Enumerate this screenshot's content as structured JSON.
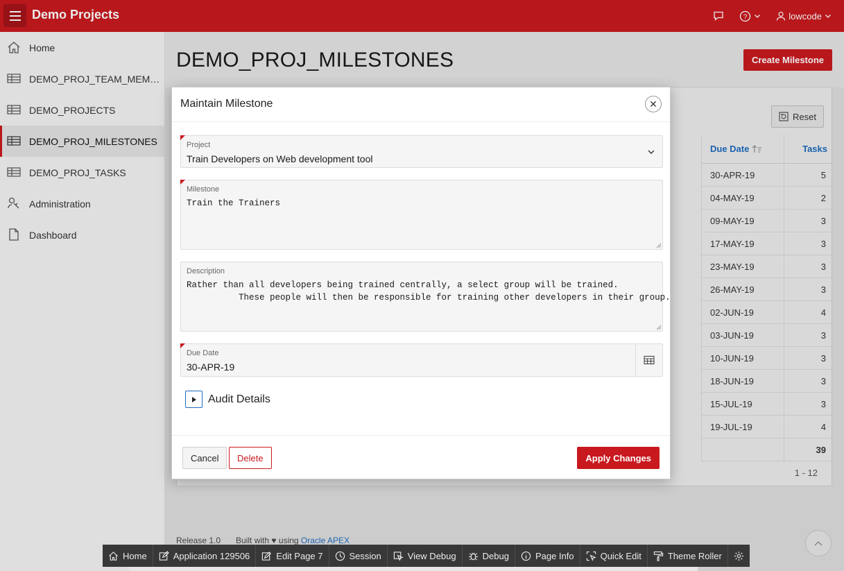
{
  "header": {
    "app_title": "Demo Projects",
    "user": "lowcode"
  },
  "sidebar": {
    "items": [
      {
        "label": "Home",
        "icon": "home-icon"
      },
      {
        "label": "DEMO_PROJ_TEAM_MEMBERS",
        "icon": "table-icon"
      },
      {
        "label": "DEMO_PROJECTS",
        "icon": "table-icon"
      },
      {
        "label": "DEMO_PROJ_MILESTONES",
        "icon": "table-icon",
        "active": true
      },
      {
        "label": "DEMO_PROJ_TASKS",
        "icon": "table-icon"
      },
      {
        "label": "Administration",
        "icon": "wrench-icon"
      },
      {
        "label": "Dashboard",
        "icon": "document-icon"
      }
    ]
  },
  "main": {
    "title": "DEMO_PROJ_MILESTONES",
    "create_label": "Create Milestone",
    "reset_label": "Reset",
    "columns": {
      "due_date": "Due Date",
      "tasks": "Tasks"
    },
    "rows": [
      {
        "due": "30-APR-19",
        "tasks": "5"
      },
      {
        "due": "04-MAY-19",
        "tasks": "2"
      },
      {
        "due": "09-MAY-19",
        "tasks": "3"
      },
      {
        "due": "17-MAY-19",
        "tasks": "3"
      },
      {
        "due": "23-MAY-19",
        "tasks": "3"
      },
      {
        "due": "26-MAY-19",
        "tasks": "3"
      },
      {
        "due": "02-JUN-19",
        "tasks": "4"
      },
      {
        "due": "03-JUN-19",
        "tasks": "3"
      },
      {
        "due": "10-JUN-19",
        "tasks": "3"
      },
      {
        "due": "18-JUN-19",
        "tasks": "3"
      },
      {
        "due": "15-JUL-19",
        "tasks": "3"
      },
      {
        "due": "19-JUL-19",
        "tasks": "4"
      }
    ],
    "total": "39",
    "pagination": "1 - 12"
  },
  "footer": {
    "release": "Release 1.0",
    "built_with": "Built with",
    "using": "using",
    "apex": "Oracle APEX"
  },
  "devbar": {
    "items": [
      {
        "label": "Home",
        "icon": "home-icon"
      },
      {
        "label": "Application 129506",
        "icon": "edit-icon"
      },
      {
        "label": "Edit Page 7",
        "icon": "pencil-icon"
      },
      {
        "label": "Session",
        "icon": "clock-icon"
      },
      {
        "label": "View Debug",
        "icon": "view-icon"
      },
      {
        "label": "Debug",
        "icon": "bug-icon"
      },
      {
        "label": "Page Info",
        "icon": "info-icon"
      },
      {
        "label": "Quick Edit",
        "icon": "select-icon"
      },
      {
        "label": "Theme Roller",
        "icon": "paint-roller-icon"
      },
      {
        "label": "",
        "icon": "gear-icon"
      }
    ]
  },
  "dialog": {
    "title": "Maintain Milestone",
    "project_label": "Project",
    "project_value": "Train Developers on Web development tool",
    "milestone_label": "Milestone",
    "milestone_value": "Train the Trainers",
    "description_label": "Description",
    "description_value": "Rather than all developers being trained centrally, a select group will be trained.\n          These people will then be responsible for training other developers in their group.",
    "due_label": "Due Date",
    "due_value": "30-APR-19",
    "audit_label": "Audit Details",
    "cancel_label": "Cancel",
    "delete_label": "Delete",
    "apply_label": "Apply Changes"
  },
  "colors": {
    "brand": "#c8191f",
    "link": "#1e6bbd"
  }
}
